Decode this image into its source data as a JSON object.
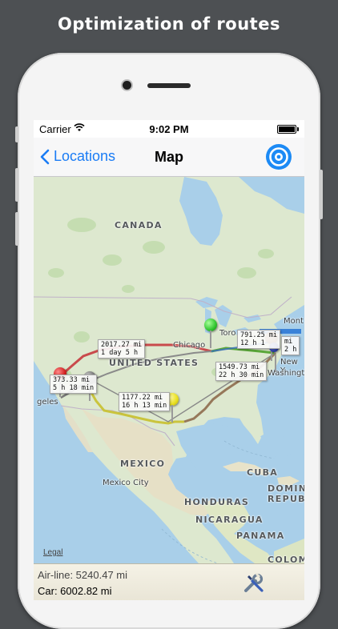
{
  "headline": "Optimization of routes",
  "status": {
    "carrier": "Carrier",
    "time": "9:02 PM"
  },
  "nav": {
    "back_label": "Locations",
    "title": "Map"
  },
  "map": {
    "labels": {
      "canada": "CANADA",
      "united_states": "UNITED STATES",
      "mexico": "MEXICO",
      "mexico_city": "Mexico City",
      "chicago": "Chicago",
      "toronto": "Toro",
      "new_york": "New Y",
      "washington": "Washington",
      "los_angeles": "geles",
      "montreal": "Mont",
      "cuba": "CUBA",
      "honduras": "HONDURAS",
      "nicaragua": "NICARAGUA",
      "panama": "PANAMA",
      "dominican": "DOMIN",
      "republic": "REPUB",
      "colombia": "COLOMBI",
      "legal": "Legal"
    },
    "routes": [
      {
        "distance": "2017.27 mi",
        "time": "1 day 5 h",
        "color": "#c6393d"
      },
      {
        "distance": "373.33 mi",
        "time": "5 h 18 min",
        "color": "#8a8a8a"
      },
      {
        "distance": "1177.22 mi",
        "time": "16 h 13 min",
        "color": "#c8c235"
      },
      {
        "distance": "1549.73 mi",
        "time": "22 h 30 min",
        "color": "#8e6b4c"
      },
      {
        "distance": "791.25 mi",
        "time": "12 h 1",
        "color": "#5ba83a"
      }
    ],
    "extra_label": {
      "line1": "mi",
      "line2": "2 h"
    },
    "pin_colors": [
      "#e02b2b",
      "#7a7a7a",
      "#e8df1e",
      "#31c52f",
      "#8b5c33",
      "#2a3fa6"
    ]
  },
  "summary": {
    "airline": "Air-line: 5240.47 mi",
    "car": "Car: 6002.82 mi"
  }
}
